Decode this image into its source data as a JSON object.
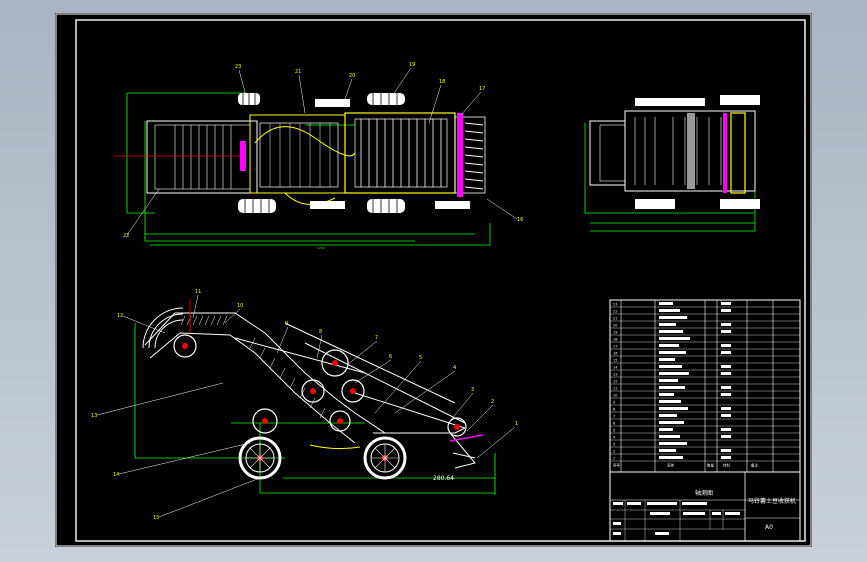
{
  "drawing": {
    "title": "轴测图",
    "machine_name": "马铃薯土豆收获机",
    "sheet_size": "A0",
    "dimension_value": "280.64",
    "top_view_labels": [
      "23",
      "21",
      "20",
      "19",
      "18",
      "17",
      "16",
      "22"
    ],
    "side_view_labels": [
      "12",
      "11",
      "10",
      "9",
      "8",
      "7",
      "6",
      "5",
      "4",
      "3",
      "2",
      "1",
      "13",
      "14",
      "15"
    ]
  },
  "parts_table": {
    "rows": [
      {
        "no": "23",
        "name": "",
        "qty": "",
        "mat": ""
      },
      {
        "no": "22",
        "name": "",
        "qty": "",
        "mat": ""
      },
      {
        "no": "21",
        "name": "",
        "qty": "",
        "mat": ""
      },
      {
        "no": "20",
        "name": "",
        "qty": "",
        "mat": ""
      },
      {
        "no": "19",
        "name": "",
        "qty": "",
        "mat": ""
      },
      {
        "no": "18",
        "name": "",
        "qty": "",
        "mat": ""
      },
      {
        "no": "17",
        "name": "",
        "qty": "",
        "mat": ""
      },
      {
        "no": "16",
        "name": "",
        "qty": "",
        "mat": ""
      },
      {
        "no": "15",
        "name": "",
        "qty": "",
        "mat": ""
      },
      {
        "no": "14",
        "name": "",
        "qty": "",
        "mat": ""
      },
      {
        "no": "13",
        "name": "",
        "qty": "",
        "mat": ""
      },
      {
        "no": "12",
        "name": "",
        "qty": "",
        "mat": ""
      },
      {
        "no": "11",
        "name": "",
        "qty": "",
        "mat": ""
      },
      {
        "no": "10",
        "name": "",
        "qty": "",
        "mat": ""
      },
      {
        "no": "9",
        "name": "",
        "qty": "",
        "mat": ""
      },
      {
        "no": "8",
        "name": "",
        "qty": "",
        "mat": ""
      },
      {
        "no": "7",
        "name": "",
        "qty": "",
        "mat": ""
      },
      {
        "no": "6",
        "name": "",
        "qty": "",
        "mat": ""
      },
      {
        "no": "5",
        "name": "",
        "qty": "",
        "mat": ""
      },
      {
        "no": "4",
        "name": "",
        "qty": "",
        "mat": ""
      },
      {
        "no": "3",
        "name": "",
        "qty": "",
        "mat": ""
      },
      {
        "no": "2",
        "name": "",
        "qty": "",
        "mat": ""
      },
      {
        "no": "1",
        "name": "",
        "qty": "",
        "mat": ""
      }
    ],
    "header": [
      "序号",
      "名称",
      "数量",
      "材料",
      "备注"
    ]
  },
  "colors": {
    "background": "#000000",
    "frame": "#ffffff",
    "yellow": "#ffff00",
    "cyan": "#00ffff",
    "green": "#00ff00",
    "red": "#ff0000",
    "magenta": "#ff00ff"
  }
}
